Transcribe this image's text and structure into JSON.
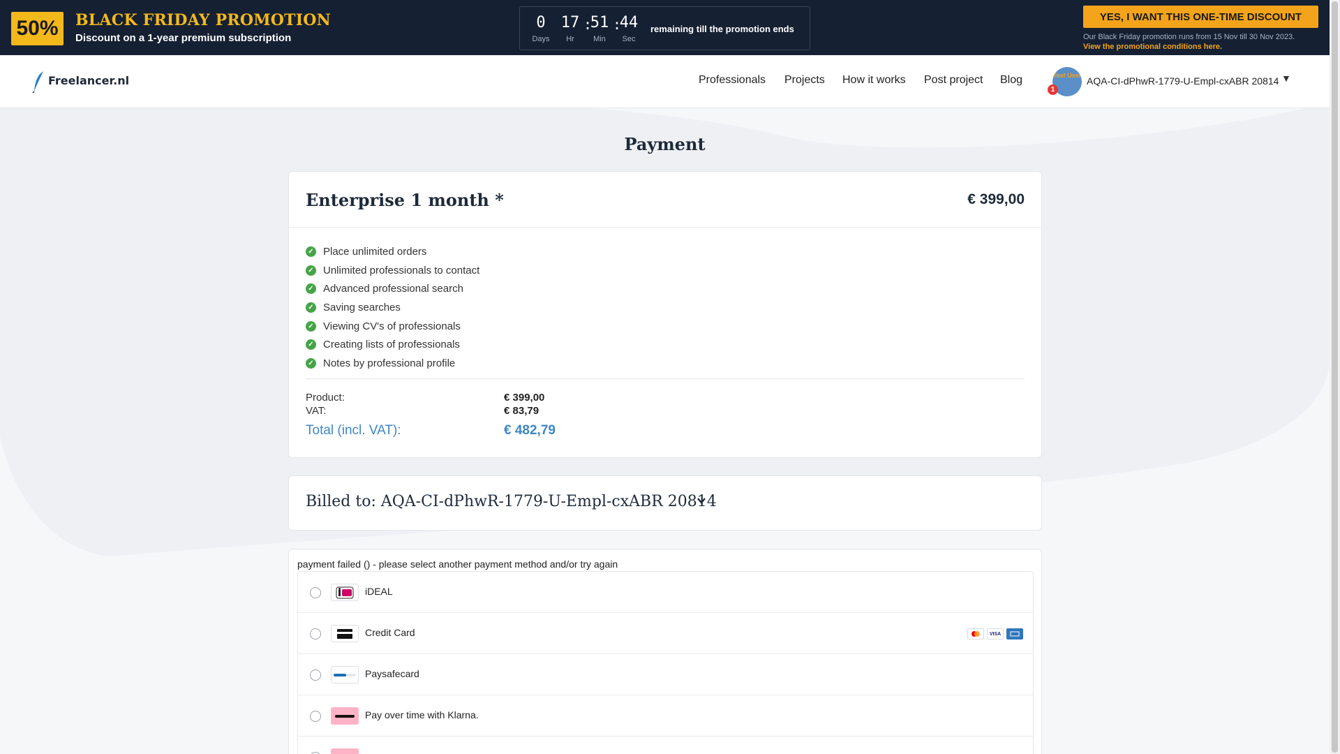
{
  "promo": {
    "badge": "50%",
    "title": "BLACK FRIDAY PROMOTION",
    "subtitle": "Discount on a 1-year premium subscription",
    "countdown": {
      "days": "0",
      "hours": "17",
      "minutes": "51",
      "seconds": "44",
      "days_label": "Days",
      "hours_label": "Hr",
      "minutes_label": "Min",
      "seconds_label": "Sec",
      "text": "remaining till the promotion ends"
    },
    "cta_label": "YES, I WANT THIS ONE-TIME DISCOUNT",
    "note": "Our Black Friday promotion runs from 15 Nov till 30 Nov 2023.",
    "link": "View the promotional conditions here.",
    "accent_color": "#f3b81b"
  },
  "nav": {
    "logo": "Freelancer.nl",
    "links": [
      "Professionals",
      "Projects",
      "How it works",
      "Post project",
      "Blog"
    ],
    "avatar_text": "Test User",
    "notification_count": "1",
    "user_name": "AQA-CI-dPhwR-1779-U-Empl-cxABR 20814"
  },
  "page": {
    "title": "Payment"
  },
  "order": {
    "plan": "Enterprise 1 month *",
    "price": "€ 399,00",
    "features": [
      "Place unlimited orders",
      "Unlimited professionals to contact",
      "Advanced professional search",
      "Saving searches",
      "Viewing CV's of professionals",
      "Creating lists of professionals",
      "Notes by professional profile"
    ],
    "product_label": "Product:",
    "product_value": "€ 399,00",
    "vat_label": "VAT:",
    "vat_value": "€ 83,79",
    "total_label": "Total (incl. VAT):",
    "total_value": "€ 482,79",
    "total_color": "#3d86c6"
  },
  "billing": {
    "label": "Billed to: AQA-CI-dPhwR-1779-U-Empl-cxABR 20814"
  },
  "payment": {
    "message": "payment failed () - please select another payment method and/or try again",
    "methods": [
      {
        "label": "iDEAL",
        "icon": "ideal-icon"
      },
      {
        "label": "Credit Card",
        "icon": "credit-card-icon"
      },
      {
        "label": "Paysafecard",
        "icon": "paysafecard-icon"
      },
      {
        "label": "Pay over time with Klarna.",
        "icon": "klarna-icon"
      }
    ],
    "card_brands": [
      "mastercard",
      "VISA",
      "AMEX"
    ]
  }
}
